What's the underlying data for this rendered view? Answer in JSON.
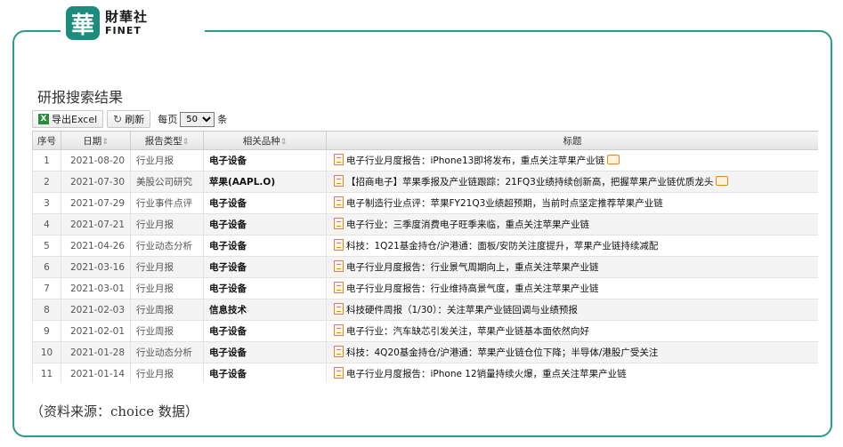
{
  "brand": {
    "seal_char": "華",
    "name_cn": "財華社",
    "name_en": "FINET",
    "accent": "#2e9a8a"
  },
  "panel": {
    "title": "研报搜索结果"
  },
  "toolbar": {
    "export_label": "导出Excel",
    "refresh_label": "刷新",
    "per_page_prefix": "每页",
    "per_page_value": "50",
    "per_page_suffix": "条"
  },
  "table": {
    "headers": {
      "no": "序号",
      "date": "日期",
      "type": "报告类型",
      "product": "相关品种",
      "title": "标题"
    },
    "rows": [
      {
        "no": "1",
        "date": "2021-08-20",
        "type": "行业月报",
        "product": "电子设备",
        "title": "电子行业月度报告：iPhone13即将发布，重点关注苹果产业链",
        "mail": true
      },
      {
        "no": "2",
        "date": "2021-07-30",
        "type": "美股公司研究",
        "product": "苹果(AAPL.O)",
        "title": "【招商电子】苹果季报及产业链跟踪：21FQ3业绩持续创新高，把握苹果产业链优质龙头",
        "mail": true
      },
      {
        "no": "3",
        "date": "2021-07-29",
        "type": "行业事件点评",
        "product": "电子设备",
        "title": "电子制造行业点评：苹果FY21Q3业绩超预期，当前时点坚定推荐苹果产业链",
        "mail": false
      },
      {
        "no": "4",
        "date": "2021-07-21",
        "type": "行业月报",
        "product": "电子设备",
        "title": "电子行业：三季度消费电子旺季来临，重点关注苹果产业链",
        "mail": false
      },
      {
        "no": "5",
        "date": "2021-04-26",
        "type": "行业动态分析",
        "product": "电子设备",
        "title": "科技：1Q21基金持仓/沪港通：面板/安防关注度提升，苹果产业链持续减配",
        "mail": false
      },
      {
        "no": "6",
        "date": "2021-03-16",
        "type": "行业月报",
        "product": "电子设备",
        "title": "电子行业月度报告：行业景气周期向上，重点关注苹果产业链",
        "mail": false
      },
      {
        "no": "7",
        "date": "2021-03-01",
        "type": "行业月报",
        "product": "电子设备",
        "title": "电子行业月度报告：行业维持高景气度，重点关注苹果产业链",
        "mail": false
      },
      {
        "no": "8",
        "date": "2021-02-03",
        "type": "行业周报",
        "product": "信息技术",
        "title": "科技硬件周报（1/30）：关注苹果产业链回调与业绩预报",
        "mail": false
      },
      {
        "no": "9",
        "date": "2021-02-01",
        "type": "行业周报",
        "product": "电子设备",
        "title": "电子行业：汽车缺芯引发关注，苹果产业链基本面依然向好",
        "mail": false
      },
      {
        "no": "10",
        "date": "2021-01-28",
        "type": "行业动态分析",
        "product": "电子设备",
        "title": "科技：4Q20基金持仓/沪港通：苹果产业链仓位下降；半导体/港股广受关注",
        "mail": false
      },
      {
        "no": "11",
        "date": "2021-01-14",
        "type": "行业月报",
        "product": "电子设备",
        "title": "电子行业月度报告：iPhone 12销量持续火爆，重点关注苹果产业链",
        "mail": false
      }
    ]
  },
  "footer": {
    "source": "（资料来源：choice 数据）"
  }
}
